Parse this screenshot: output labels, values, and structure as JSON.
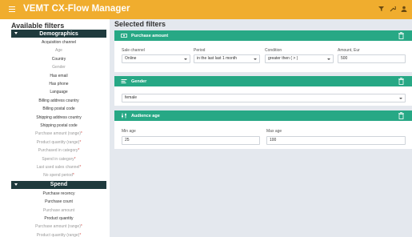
{
  "app": {
    "title": "VEMT CX-Flow Manager",
    "header_icons": [
      "filter-settings-icon",
      "tools-icon",
      "user-icon"
    ]
  },
  "sidebar": {
    "title": "Available filters",
    "sections": [
      {
        "label": "Demographics",
        "items": [
          {
            "label": "Acquisition channel",
            "muted": false
          },
          {
            "label": "Age",
            "muted": true
          },
          {
            "label": "Country",
            "muted": false
          },
          {
            "label": "Gender",
            "muted": true
          },
          {
            "label": "Has email",
            "muted": false
          },
          {
            "label": "Has phone",
            "muted": false
          },
          {
            "label": "Language",
            "muted": false
          },
          {
            "label": "Billing address country",
            "muted": false
          },
          {
            "label": "Billing postal code",
            "muted": false
          },
          {
            "label": "Shipping address country",
            "muted": false
          },
          {
            "label": "Shipping postal code",
            "muted": false
          },
          {
            "label": "Purchase amount (range)",
            "muted": true,
            "star": "*"
          },
          {
            "label": "Product quantity (range)",
            "muted": true,
            "star": "*"
          },
          {
            "label": "Purchased in category",
            "muted": true,
            "star": "*"
          },
          {
            "label": "Spend in category",
            "muted": true,
            "star": "*"
          },
          {
            "label": "Last used sales channel",
            "muted": true,
            "star": "*"
          },
          {
            "label": "No spend period",
            "muted": true,
            "star": "*"
          }
        ]
      },
      {
        "label": "Spend",
        "items": [
          {
            "label": "Purchase recency",
            "muted": false
          },
          {
            "label": "Purchase count",
            "muted": false
          },
          {
            "label": "Purchase amount",
            "muted": true
          },
          {
            "label": "Product quantity",
            "muted": false
          },
          {
            "label": "Purchase amount (range)",
            "muted": true,
            "star": "*"
          },
          {
            "label": "Product quantity (range)",
            "muted": true,
            "star": "*"
          }
        ]
      }
    ]
  },
  "main": {
    "title": "Selected filters",
    "cards": [
      {
        "title": "Purchase amount",
        "icon": "money-icon",
        "fields": [
          {
            "label": "Sale channel",
            "value": "Online",
            "type": "select"
          },
          {
            "label": "Period",
            "value": "in the last last 1 month",
            "type": "select"
          },
          {
            "label": "Condition",
            "value": "greater then ( > )",
            "type": "select"
          },
          {
            "label": "Amount, Eur",
            "value": "500",
            "type": "input"
          }
        ]
      },
      {
        "title": "Gender",
        "icon": "list-icon",
        "fields": [
          {
            "label": "",
            "value": "female",
            "type": "select"
          }
        ]
      },
      {
        "title": "Audience age",
        "icon": "sliders-icon",
        "fields": [
          {
            "label": "Min age",
            "value": "25",
            "type": "input"
          },
          {
            "label": "Max age",
            "value": "100",
            "type": "input"
          }
        ]
      }
    ]
  },
  "colors": {
    "topbar": "#f0ad2e",
    "section_header": "#1f3a3d",
    "card_header": "#27a885",
    "background": "#e4e8ee"
  }
}
